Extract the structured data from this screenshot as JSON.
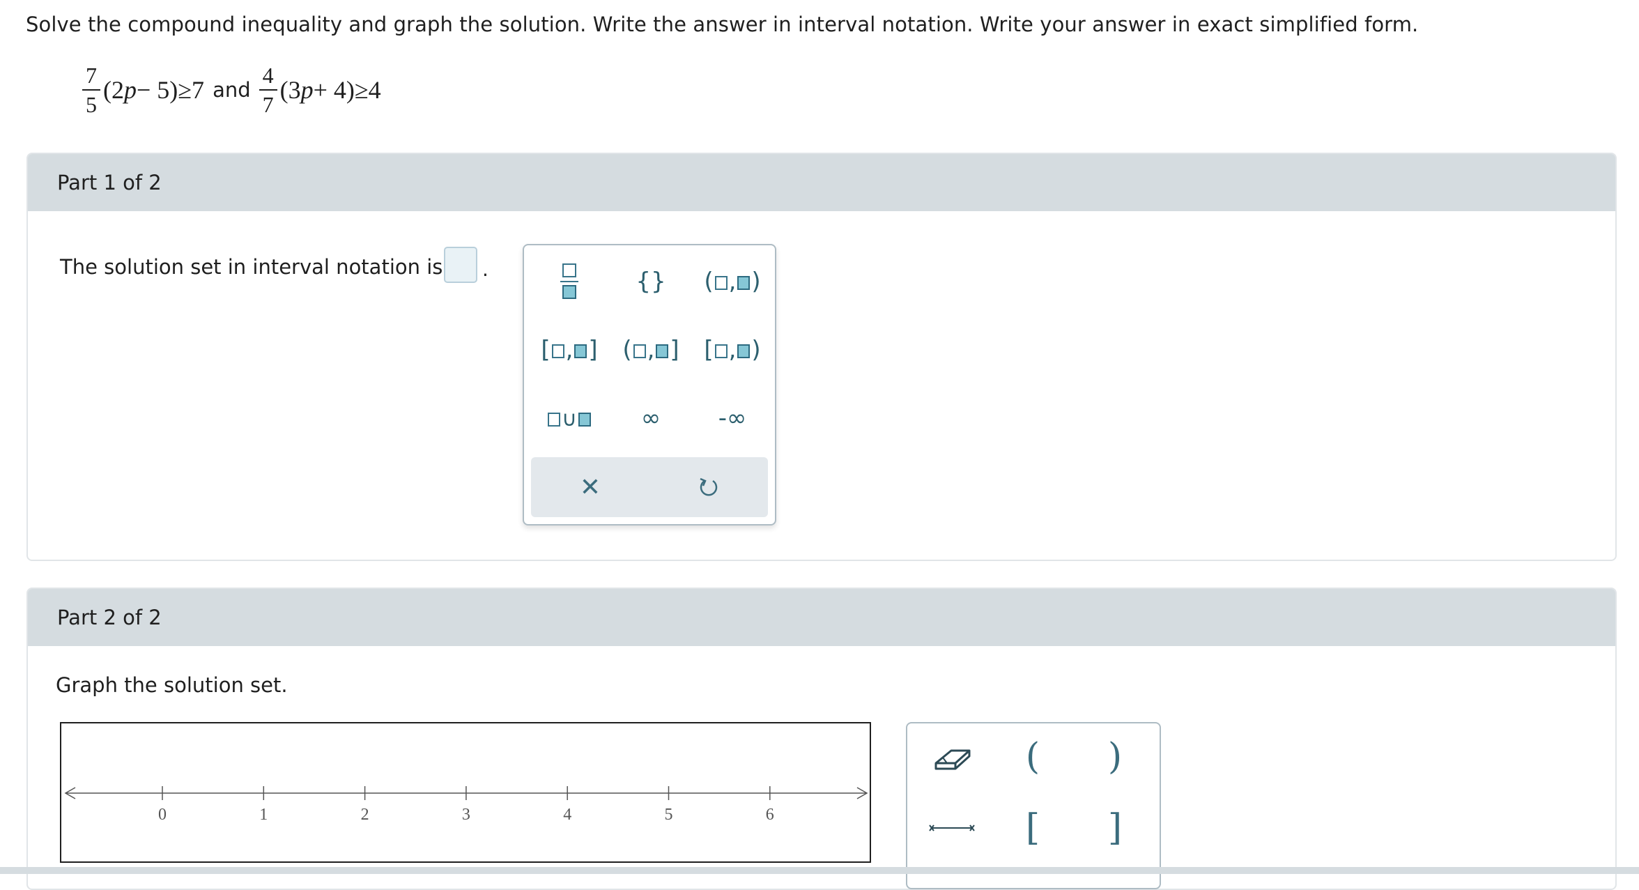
{
  "instructions": "Solve the compound inequality and graph the solution. Write the answer in interval notation. Write your answer in exact simplified form.",
  "equation": {
    "frac1_num": "7",
    "frac1_den": "5",
    "left1": "(2",
    "var1": "p",
    "right1": "− 5)≥7",
    "and": "and",
    "frac2_num": "4",
    "frac2_den": "7",
    "left2": "(3",
    "var2": "p",
    "right2": "+ 4)≥4"
  },
  "part1": {
    "title": "Part 1 of 2",
    "prompt": "The solution set in interval notation is",
    "period": ".",
    "palette": {
      "buttons": [
        "fraction",
        "set-braces",
        "open-open-interval",
        "closed-closed-interval",
        "open-closed-interval",
        "closed-open-interval",
        "union",
        "infinity",
        "negative-infinity"
      ],
      "braces_label": "{}",
      "infinity_label": "∞",
      "neg_infinity_label": "-∞",
      "clear_label": "✕",
      "undo_label": "↺"
    }
  },
  "part2": {
    "title": "Part 2 of 2",
    "prompt": "Graph the solution set.",
    "number_line": {
      "min_label": 0,
      "max_label": 6,
      "ticks": [
        "0",
        "1",
        "2",
        "3",
        "4",
        "5",
        "6"
      ]
    },
    "tools": {
      "open_left": "(",
      "open_right": ")",
      "closed_left": "[",
      "closed_right": "]"
    }
  },
  "colors": {
    "accent": "#2c5f6e",
    "header_bg": "#d5dce0",
    "answer_box": "#e9f2f6"
  }
}
